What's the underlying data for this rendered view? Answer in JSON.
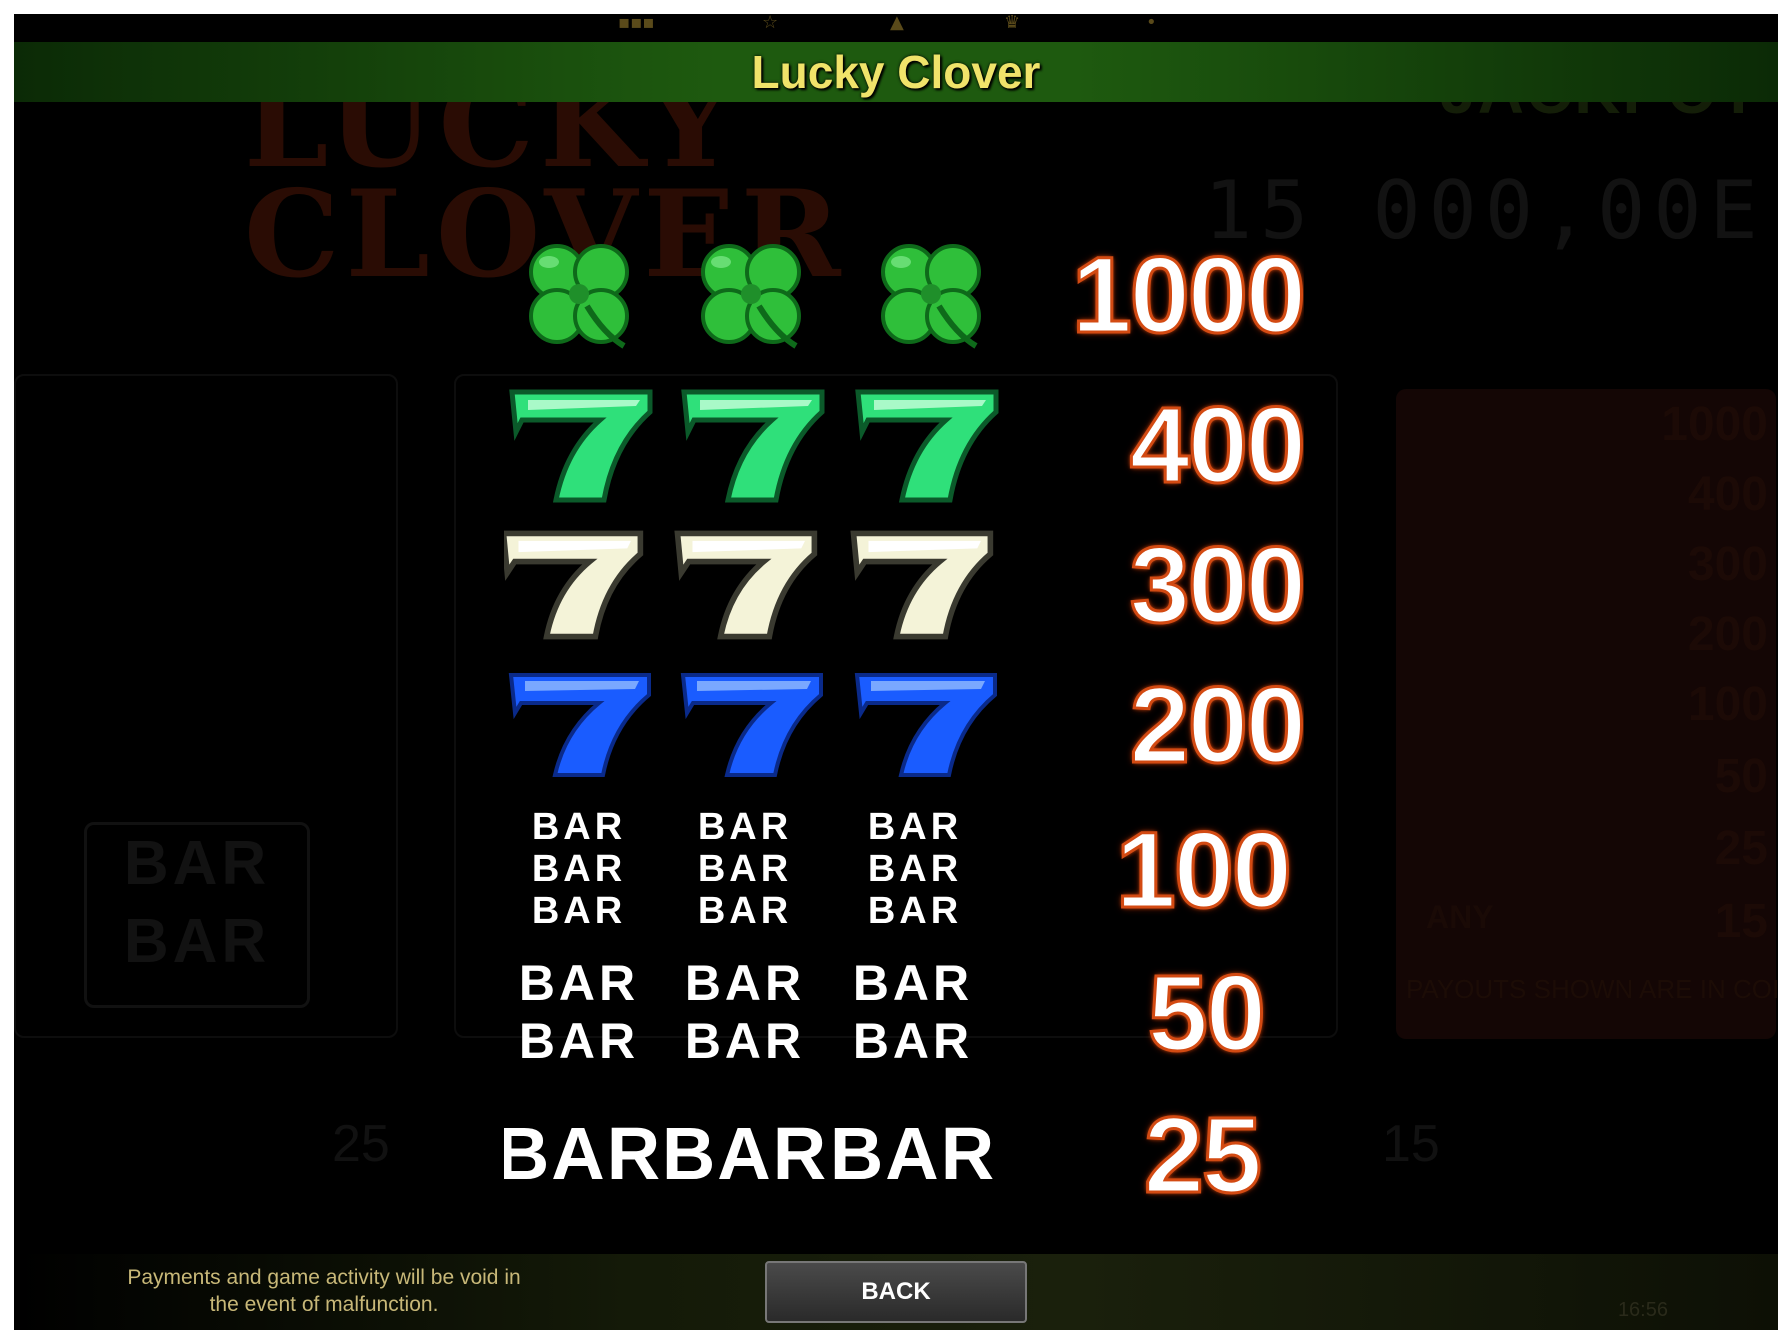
{
  "header": {
    "title": "Lucky Clover"
  },
  "background": {
    "logo_line1": "LUCKY",
    "logo_line2": "CLOVER",
    "jackpot_label": "JACKPOT",
    "jackpot_value": "15 000,00E",
    "left_bar": "BAR BAR",
    "bottom_left_number": "25",
    "bottom_right_number": "15",
    "right_payouts": [
      "1000",
      "400",
      "300",
      "200",
      "100",
      "50",
      "25",
      "15"
    ],
    "right_note": "PAYOUTS SHOWN ARE IN COIN",
    "right_any": "ANY",
    "clock": "16:56"
  },
  "paytable": {
    "rows": [
      {
        "symbol": "clover",
        "payout": "1000"
      },
      {
        "symbol": "green-seven",
        "payout": "400"
      },
      {
        "symbol": "white-seven",
        "payout": "300"
      },
      {
        "symbol": "blue-seven",
        "payout": "200"
      },
      {
        "symbol": "triple-bar",
        "payout": "100",
        "bar_text": "BAR"
      },
      {
        "symbol": "double-bar",
        "payout": "50",
        "bar_text": "BAR"
      },
      {
        "symbol": "single-bar",
        "payout": "25",
        "bar_text": "BAR"
      }
    ],
    "peek_bar_text": "BAR",
    "peek_payout": "15"
  },
  "colors": {
    "clover_green": "#2fbf3a",
    "green_seven": "#2fe07a",
    "white_seven": "#f4f3d8",
    "blue_seven": "#1a5cff",
    "payout_outline": "#d34a12",
    "title_yellow": "#f0e36a"
  },
  "footer": {
    "disclaimer": "Payments and game activity will be void in the event of malfunction.",
    "back_label": "BACK"
  }
}
